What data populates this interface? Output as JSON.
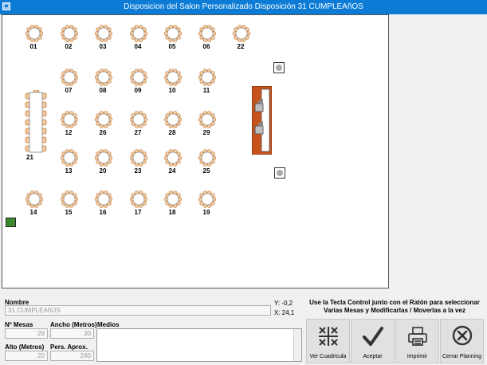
{
  "window": {
    "title": "Disposicion del Salon Personalizado Disposición 31 CUMPLEAñOS"
  },
  "tables": [
    {
      "label": "01"
    },
    {
      "label": "02"
    },
    {
      "label": "03"
    },
    {
      "label": "04"
    },
    {
      "label": "05"
    },
    {
      "label": "06"
    },
    {
      "label": "22"
    },
    {
      "label": "07"
    },
    {
      "label": "08"
    },
    {
      "label": "09"
    },
    {
      "label": "10"
    },
    {
      "label": "11"
    },
    {
      "label": "12"
    },
    {
      "label": "26"
    },
    {
      "label": "27"
    },
    {
      "label": "28"
    },
    {
      "label": "29"
    },
    {
      "label": "13"
    },
    {
      "label": "20"
    },
    {
      "label": "23"
    },
    {
      "label": "24"
    },
    {
      "label": "25"
    },
    {
      "label": "14"
    },
    {
      "label": "15"
    },
    {
      "label": "16"
    },
    {
      "label": "17"
    },
    {
      "label": "18"
    },
    {
      "label": "19"
    }
  ],
  "long_table": {
    "label": "21"
  },
  "form": {
    "nombre_label": "Nombre",
    "nombre_value": "31 CUMPLEAñOS",
    "mesas_label": "Nº Mesas",
    "mesas_value": "29",
    "ancho_label": "Ancho (Metros)",
    "ancho_value": "30",
    "medios_label": "Medios",
    "alto_label": "Alto (Metros)",
    "alto_value": "20",
    "pers_label": "Pers. Aprox.",
    "pers_value": "240"
  },
  "coords": {
    "y": "Y: -0,2",
    "x": "X: 24,1"
  },
  "hint": "Use la Tecla Control junto con el Ratón para seleccionar Varias Mesas y Modificarlas / Moverlas a la vez",
  "buttons": {
    "ver_cuadricula": "Ver Cuadricula",
    "aceptar": "Aceptar",
    "imprimir": "Imprimir",
    "cerrar_planning": "Cerrar Planning"
  }
}
